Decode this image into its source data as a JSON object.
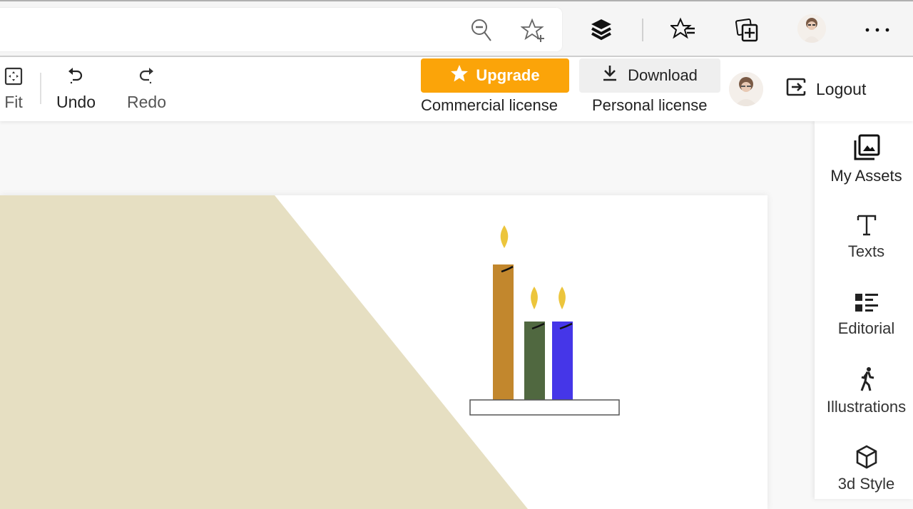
{
  "browser": {
    "address_value": "",
    "icons": [
      "zoom-out-icon",
      "add-favorite-icon",
      "layers-extension-icon",
      "favorites-icon",
      "collections-icon",
      "profile-avatar",
      "more-menu-icon"
    ]
  },
  "toolbar": {
    "fit_label": "Fit",
    "undo_label": "Undo",
    "redo_label": "Redo",
    "upgrade_label": "Upgrade",
    "upgrade_sublabel": "Commercial license",
    "download_label": "Download",
    "download_sublabel": "Personal license",
    "logout_label": "Logout"
  },
  "colors": {
    "accent_upgrade": "#fba409",
    "download_bg": "#efefef",
    "canvas_beige": "#e6dfc2",
    "candle_tall": "#c2872d",
    "candle_green": "#506840",
    "candle_blue": "#4536e8",
    "flame": "#ecc53c"
  },
  "sidebar": {
    "items": [
      {
        "label": "My Assets",
        "icon": "assets-icon"
      },
      {
        "label": "Texts",
        "icon": "text-icon"
      },
      {
        "label": "Editorial",
        "icon": "editorial-icon"
      },
      {
        "label": "Illustrations",
        "icon": "illustration-icon"
      },
      {
        "label": "3d Style",
        "icon": "cube-icon"
      }
    ]
  }
}
